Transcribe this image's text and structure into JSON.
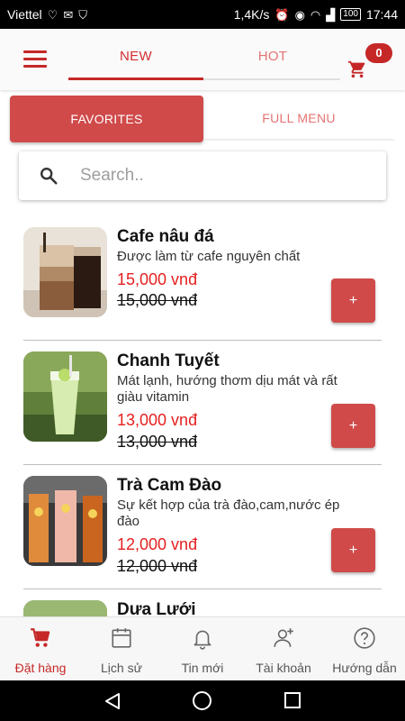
{
  "status_bar": {
    "carrier": "Viettel",
    "speed": "1,4K/s",
    "battery": "100",
    "time": "17:44"
  },
  "app_bar": {
    "tabs": [
      {
        "label": "NEW",
        "active": true
      },
      {
        "label": "HOT",
        "active": false
      }
    ],
    "cart_count": "0"
  },
  "segments": {
    "favorites": "FAVORITES",
    "full_menu": "FULL MENU"
  },
  "search": {
    "placeholder": "Search.."
  },
  "products": [
    {
      "name": "Cafe nâu đá",
      "desc": "Được làm từ cafe nguyên chất",
      "price": "15,000 vnđ",
      "old_price": "15,000 vnđ",
      "add_label": "+"
    },
    {
      "name": "Chanh Tuyết",
      "desc": "Mát lạnh, hướng thơm dịu mát và rất giàu vitamin",
      "price": "13,000 vnđ",
      "old_price": "13,000 vnđ",
      "add_label": "+"
    },
    {
      "name": "Trà Cam Đào",
      "desc": "Sự kết hợp của trà đào,cam,nước ép đào",
      "price": "12,000 vnđ",
      "old_price": "12,000 vnđ",
      "add_label": "+"
    },
    {
      "name": "Dưa Lưới"
    }
  ],
  "bottom_nav": [
    {
      "label": "Đặt hàng",
      "icon": "cart-icon",
      "active": true
    },
    {
      "label": "Lịch sử",
      "icon": "calendar-icon",
      "active": false
    },
    {
      "label": "Tin mới",
      "icon": "bell-icon",
      "active": false
    },
    {
      "label": "Tài khoản",
      "icon": "add-user-icon",
      "active": false
    },
    {
      "label": "Hướng dẫn",
      "icon": "help-icon",
      "active": false
    }
  ],
  "colors": {
    "primary": "#c62828",
    "button": "#d04a4a",
    "price": "#e52020"
  }
}
